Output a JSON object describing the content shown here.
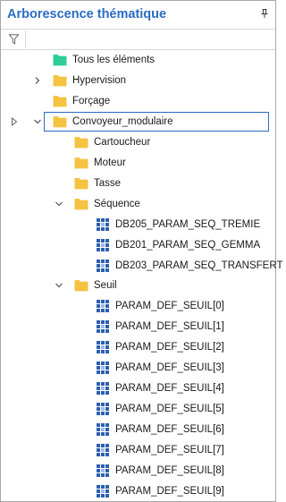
{
  "panel": {
    "title": "Arborescence thématique",
    "pin_icon": "pin-icon",
    "filter_icon": "filter-icon"
  },
  "tree": {
    "items": [
      {
        "label": "Tous les éléments",
        "icon": "folder-green-icon",
        "level": 0,
        "expander": "none"
      },
      {
        "label": "Hypervision",
        "icon": "folder-icon",
        "level": 0,
        "expander": "collapsed"
      },
      {
        "label": "Forçage",
        "icon": "folder-icon",
        "level": 0,
        "expander": "none"
      },
      {
        "label": "Convoyeur_modulaire",
        "icon": "folder-icon",
        "level": 0,
        "expander": "expanded",
        "selected": true
      },
      {
        "label": "Cartoucheur",
        "icon": "folder-icon",
        "level": 1,
        "expander": "none"
      },
      {
        "label": "Moteur",
        "icon": "folder-icon",
        "level": 1,
        "expander": "none"
      },
      {
        "label": "Tasse",
        "icon": "folder-icon",
        "level": 1,
        "expander": "none"
      },
      {
        "label": "Séquence",
        "icon": "folder-icon",
        "level": 1,
        "expander": "expanded"
      },
      {
        "label": "DB205_PARAM_SEQ_TREMIE",
        "icon": "data-block-icon",
        "level": 2,
        "expander": "none"
      },
      {
        "label": "DB201_PARAM_SEQ_GEMMA",
        "icon": "data-block-icon",
        "level": 2,
        "expander": "none"
      },
      {
        "label": "DB203_PARAM_SEQ_TRANSFERT",
        "icon": "data-block-icon",
        "level": 2,
        "expander": "none"
      },
      {
        "label": "Seuil",
        "icon": "folder-icon",
        "level": 1,
        "expander": "expanded"
      },
      {
        "label": "PARAM_DEF_SEUIL[0]",
        "icon": "data-block-icon",
        "level": 2,
        "expander": "none"
      },
      {
        "label": "PARAM_DEF_SEUIL[1]",
        "icon": "data-block-icon",
        "level": 2,
        "expander": "none"
      },
      {
        "label": "PARAM_DEF_SEUIL[2]",
        "icon": "data-block-icon",
        "level": 2,
        "expander": "none"
      },
      {
        "label": "PARAM_DEF_SEUIL[3]",
        "icon": "data-block-icon",
        "level": 2,
        "expander": "none"
      },
      {
        "label": "PARAM_DEF_SEUIL[4]",
        "icon": "data-block-icon",
        "level": 2,
        "expander": "none"
      },
      {
        "label": "PARAM_DEF_SEUIL[5]",
        "icon": "data-block-icon",
        "level": 2,
        "expander": "none"
      },
      {
        "label": "PARAM_DEF_SEUIL[6]",
        "icon": "data-block-icon",
        "level": 2,
        "expander": "none"
      },
      {
        "label": "PARAM_DEF_SEUIL[7]",
        "icon": "data-block-icon",
        "level": 2,
        "expander": "none"
      },
      {
        "label": "PARAM_DEF_SEUIL[8]",
        "icon": "data-block-icon",
        "level": 2,
        "expander": "none"
      },
      {
        "label": "PARAM_DEF_SEUIL[9]",
        "icon": "data-block-icon",
        "level": 2,
        "expander": "none"
      }
    ]
  },
  "colors": {
    "title": "#2b6cc4",
    "folder": "#f5c342",
    "folder_green": "#2ecc9a",
    "selection_border": "#2b6cc4",
    "data_block": "#2b5fb0"
  }
}
